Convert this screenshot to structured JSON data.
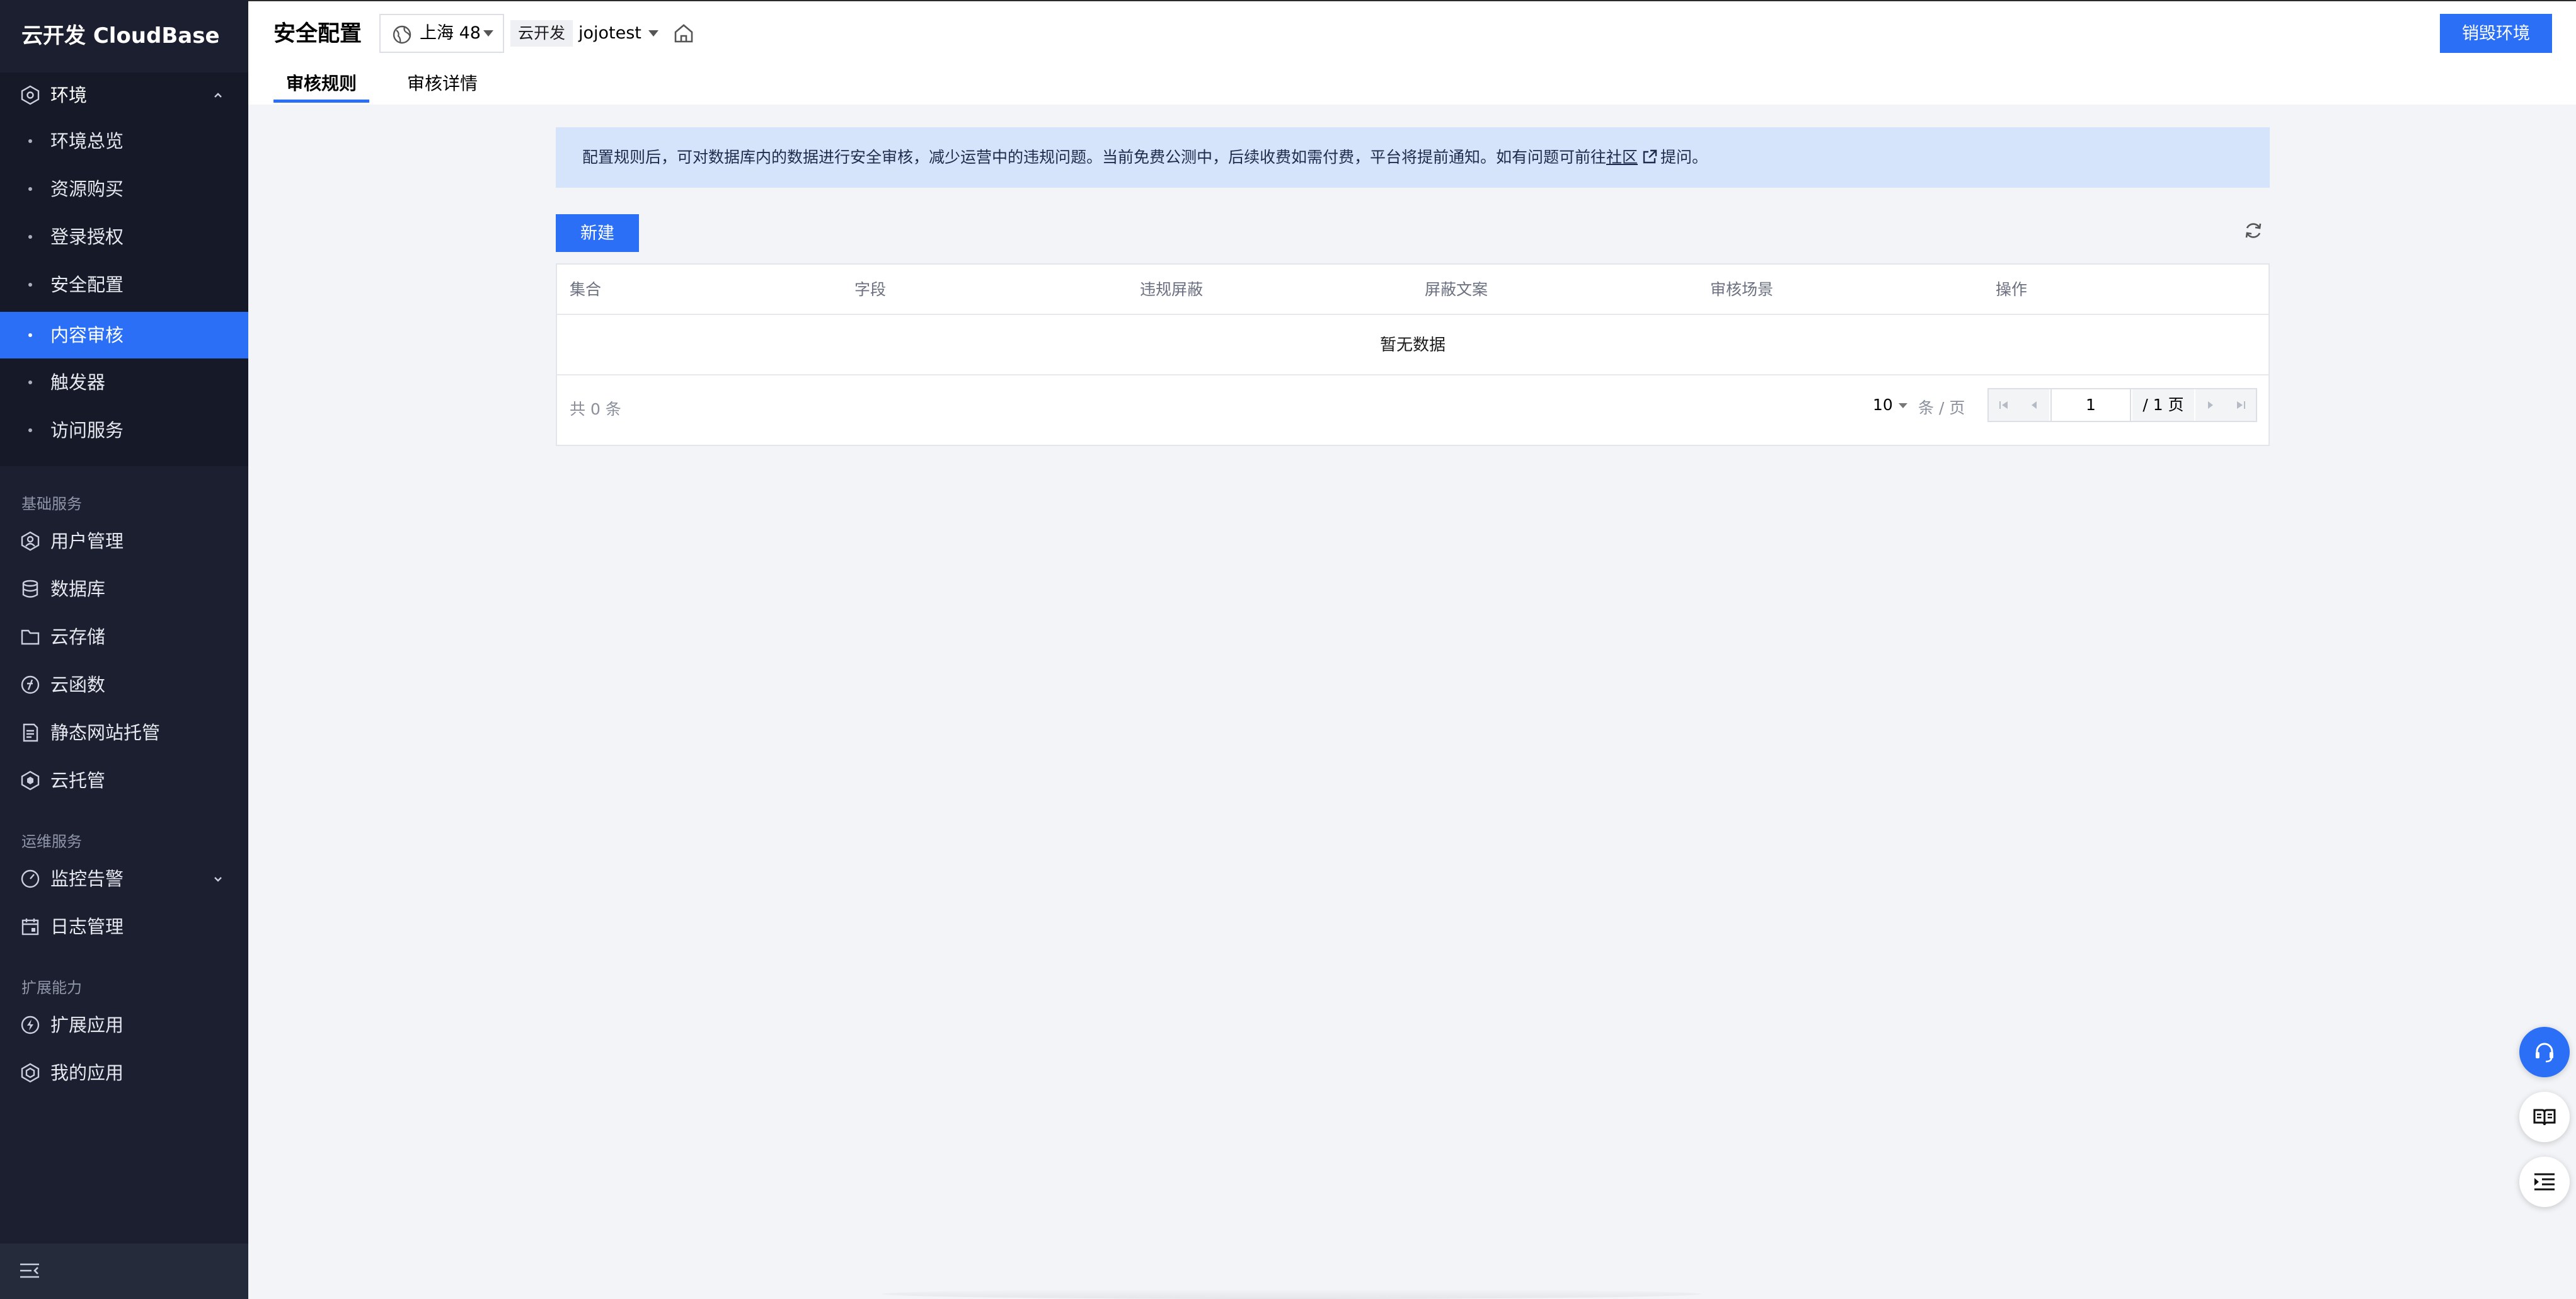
{
  "sidebar": {
    "brand": "云开发 CloudBase",
    "env_group": {
      "label": "环境",
      "items": [
        {
          "label": "环境总览"
        },
        {
          "label": "资源购买"
        },
        {
          "label": "登录授权"
        },
        {
          "label": "安全配置"
        },
        {
          "label": "内容审核"
        },
        {
          "label": "触发器"
        },
        {
          "label": "访问服务"
        }
      ],
      "active": "内容审核"
    },
    "sections": [
      {
        "title": "基础服务",
        "items": [
          {
            "label": "用户管理",
            "icon": "user-hex-icon"
          },
          {
            "label": "数据库",
            "icon": "database-icon"
          },
          {
            "label": "云存储",
            "icon": "folder-icon"
          },
          {
            "label": "云函数",
            "icon": "function-icon"
          },
          {
            "label": "静态网站托管",
            "icon": "document-icon"
          },
          {
            "label": "云托管",
            "icon": "hexagon-icon"
          }
        ]
      },
      {
        "title": "运维服务",
        "items": [
          {
            "label": "监控告警",
            "icon": "gauge-icon"
          },
          {
            "label": "日志管理",
            "icon": "calendar-icon"
          }
        ]
      },
      {
        "title": "扩展能力",
        "items": [
          {
            "label": "扩展应用",
            "icon": "bolt-icon"
          },
          {
            "label": "我的应用",
            "icon": "app-hex-icon"
          }
        ]
      }
    ]
  },
  "topbar": {
    "title": "安全配置",
    "region": "上海 48",
    "env_tag": "云开发",
    "env_name": "jojotest",
    "destroy_label": "销毁环境",
    "tabs": [
      {
        "label": "审核规则"
      },
      {
        "label": "审核详情"
      }
    ]
  },
  "notice": {
    "text": "配置规则后，可对数据库内的数据进行安全审核，减少运营中的违规问题。当前免费公测中，后续收费如需付费，平台将提前通知。如有问题可前往",
    "link": "社区",
    "suffix": "提问。"
  },
  "toolbar": {
    "new_label": "新建"
  },
  "table": {
    "columns": [
      "集合",
      "字段",
      "违规屏蔽",
      "屏蔽文案",
      "审核场景",
      "操作"
    ],
    "empty_text": "暂无数据",
    "total_text": "共  0  条",
    "page_size": "10",
    "per_page_text": "条 / 页",
    "current_page": "1",
    "total_pages_text": "/ 1 页"
  },
  "colors": {
    "primary": "#2a6ff5",
    "sidebar_bg": "#1b1f2f",
    "notice_bg": "#d6e4fb"
  }
}
